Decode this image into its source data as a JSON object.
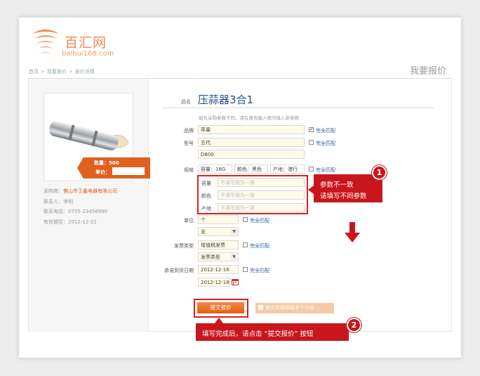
{
  "brand": {
    "name_cn": "百汇网",
    "domain": "baihui168.com"
  },
  "breadcrumb": [
    "首页",
    ">",
    "我要报价",
    ">",
    "报价详情"
  ],
  "page_heading": "我要报价",
  "product_tag": {
    "qty_label": "数量：500",
    "price_label": "单价："
  },
  "supplier": {
    "buyer_label": "采购商：",
    "buyer": "佛山市王鑫电器有限公司",
    "contact": "联系人：李明",
    "phone": "联系电话：0755-23456990",
    "deadline": "有效期至：2012-12-22"
  },
  "form": {
    "name_label": "品名",
    "product_name": "压蒜器3合1",
    "hint": "如与采购参数不同，请在黄色输入框内填入新参数",
    "brand_label": "品牌",
    "brand_value": "苹果",
    "model_label": "型号",
    "model_value": "五代",
    "model_extra": "D800",
    "spec_label": "规格",
    "spec_chips": [
      "容量：16G",
      "颜色：黑色",
      "产地：港行"
    ],
    "spec_rows": [
      {
        "label": "容量",
        "placeholder": "不填写视为一致"
      },
      {
        "label": "颜色",
        "placeholder": "不填写视为一致"
      },
      {
        "label": "产地",
        "placeholder": "不填写视为一致"
      }
    ],
    "unit_label": "单位",
    "unit_value": "个",
    "unit_select": "支",
    "invoice_label": "发票类型",
    "invoice_value": "增值税发票",
    "invoice_select": "发票类型",
    "delivery_label": "承诺到货日期",
    "delivery_value": "2012-12-16",
    "delivery_date": "2012-12-18",
    "match_label": "完全匹配",
    "submit_label": "提交报价",
    "submit_multi_label": "提交并继续报多个价格"
  },
  "callouts": {
    "one_number": "1",
    "one_line1": "参数不一致",
    "one_line2": "请填写不同参数",
    "two_number": "2",
    "two_text": "填写完成后，请点击 “提交报价” 按钮"
  },
  "colors": {
    "accent": "#e0601f",
    "callout_red": "#c9161d",
    "link_blue": "#1d4f8c",
    "input_yellow": "#fffbe8"
  },
  "icons": [
    "logo-mark-icon",
    "calendar-icon",
    "down-arrow-icon",
    "edit-icon",
    "checkbox-checked-icon"
  ]
}
